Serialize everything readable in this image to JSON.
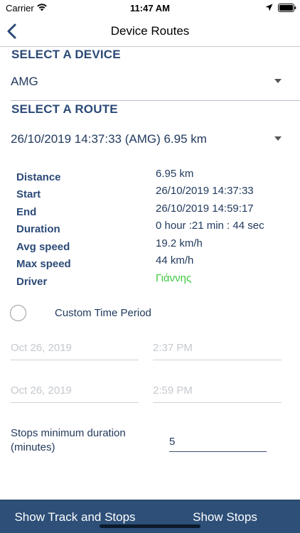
{
  "status_bar": {
    "carrier": "Carrier",
    "time": "11:47 AM"
  },
  "nav": {
    "title": "Device Routes"
  },
  "device_section": {
    "header": "SELECT A DEVICE",
    "selected": "AMG"
  },
  "route_section": {
    "header": "SELECT A ROUTE",
    "selected": "26/10/2019 14:37:33 (AMG) 6.95 km"
  },
  "details": [
    {
      "label": "Distance",
      "value": "6.95 km"
    },
    {
      "label": "Start",
      "value": "26/10/2019 14:37:33"
    },
    {
      "label": "End",
      "value": "26/10/2019 14:59:17"
    },
    {
      "label": "Duration",
      "value": "0 hour :21 min : 44 sec"
    },
    {
      "label": "Avg speed",
      "value": "19.2 km/h"
    },
    {
      "label": "Max speed",
      "value": "44 km/h"
    },
    {
      "label": "Driver",
      "value": "Γιάννης"
    }
  ],
  "custom_period": {
    "label": "Custom Time Period",
    "checked": false
  },
  "date_fields": {
    "start_date": "Oct 26, 2019",
    "start_time": "2:37 PM",
    "end_date": "Oct 26, 2019",
    "end_time": "2:59 PM"
  },
  "stops": {
    "label_line1": "Stops minimum duration",
    "label_line2": "(minutes)",
    "value": "5"
  },
  "bottom_bar": {
    "track_and_stops": "Show Track and Stops",
    "stops": "Show Stops"
  },
  "colors": {
    "accent": "#2d4f78",
    "driver": "#3cc83c",
    "header": "#2b4a77"
  }
}
